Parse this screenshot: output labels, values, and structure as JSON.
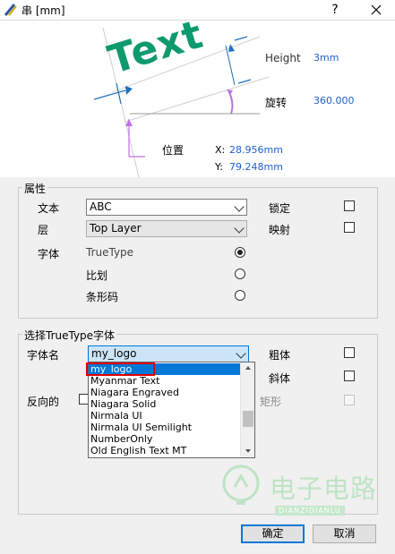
{
  "window": {
    "title": "串 [mm]",
    "help_btn": "?",
    "close_btn": "X"
  },
  "preview": {
    "sample_text": "Text",
    "height_label": "Height",
    "height_value": "3mm",
    "rotation_label": "旋转",
    "rotation_value": "360.000",
    "position_label": "位置",
    "x_label": "X:",
    "x_value": "28.956mm",
    "y_label": "Y:",
    "y_value": "79.248mm"
  },
  "properties": {
    "group_title": "属性",
    "text_label": "文本",
    "text_value": "ABC",
    "layer_label": "层",
    "layer_value": "Top Layer",
    "font_label": "字体",
    "font_options": [
      "TrueType",
      "比划",
      "条形码"
    ],
    "selected_font_option": "TrueType",
    "lock_label": "锁定",
    "lock_checked": false,
    "mirror_label": "映射",
    "mirror_checked": false
  },
  "truetype": {
    "group_title": "选择TrueType字体",
    "fontname_label": "字体名",
    "fontname_value": "my_logo",
    "bold_label": "粗体",
    "bold_checked": false,
    "italic_label": "斜体",
    "italic_checked": false,
    "inverted_label": "反向的",
    "inverted_rect_label": "矩形",
    "font_list": [
      "my_logo",
      "Myanmar Text",
      "Niagara Engraved",
      "Niagara Solid",
      "Nirmala UI",
      "Nirmala UI Semilight",
      "NumberOnly",
      "Old English Text MT"
    ],
    "selected_font": "my_logo"
  },
  "watermark": {
    "cn": "电子电路",
    "en": "DIANZIDIANLU"
  },
  "buttons": {
    "ok": "确定",
    "cancel": "取消"
  },
  "colors": {
    "text_sample": "#0f9a6e",
    "accent_blue": "#1f5fd1",
    "selection": "#0078d7",
    "highlight_box": "#e00000",
    "angle_arc": "#c070e0"
  }
}
